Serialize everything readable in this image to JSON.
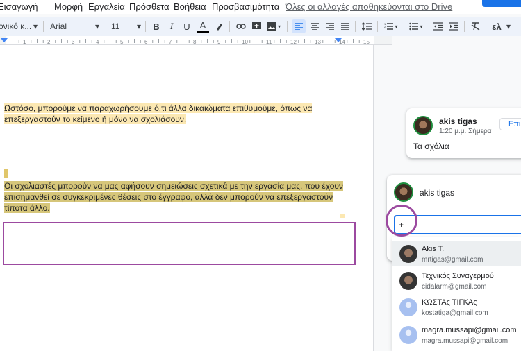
{
  "menubar": {
    "items": [
      "Εισαγωγή",
      "Μορφή",
      "Εργαλεία",
      "Πρόσθετα",
      "Βοήθεια",
      "Προσβασιμότητα"
    ],
    "save_status": "Όλες οι αλλαγές αποθηκεύονται στο Drive"
  },
  "toolbar": {
    "style": "ονικό κ...",
    "font": "Arial",
    "font_size": "11",
    "bold": "B",
    "italic": "I",
    "underline": "U",
    "text_color": "A",
    "language": "ελ"
  },
  "ruler": {
    "ticks": [
      "1",
      "2",
      "3",
      "4",
      "5",
      "6",
      "7",
      "8",
      "9",
      "10",
      "11",
      "12",
      "13",
      "14",
      "15"
    ]
  },
  "document": {
    "para1_line1": "Ωστόσο, μπορούμε να παραχωρήσουμε ό,τι άλλα δικαιώματα επιθυμούμε, όπως να",
    "para1_line2": "επεξεργαστούν το κείμενο ή μόνο να σχολιάσουν.",
    "para2_line1": "Οι σχολιαστές μπορούν να μας αφήσουν σημειώσεις σχετικά με την εργασία μας, που έχουν",
    "para2_line2": "επισημανθεί σε συγκεκριμένες θέσεις στο έγγραφο, αλλά δεν μπορούν να επεξεργαστούν",
    "para2_line3": "τίποτα άλλο."
  },
  "comment_existing": {
    "author": "akis tigas",
    "time": "1:20 μ.μ. Σήμερα",
    "text": "Τα σχόλια",
    "edit_label": "Επιλ"
  },
  "comment_new": {
    "author": "akis tigas",
    "input_value": "+"
  },
  "suggestions": [
    {
      "name": "Akis T.",
      "email": "mrtigas@gmail.com"
    },
    {
      "name": "Τεχνικός Συναγερμού",
      "email": "cidalarm@gmail.com"
    },
    {
      "name": "ΚΩΣΤΑς ΤΙΓΚΑς",
      "email": "kostatiga@gmail.com"
    },
    {
      "name": "magra.mussapi@gmail.com",
      "email": "magra.mussapi@gmail.com"
    }
  ],
  "colors": {
    "accent": "#1a73e8",
    "highlight": "#fce8b2",
    "annotation": "#9c4aa0"
  }
}
